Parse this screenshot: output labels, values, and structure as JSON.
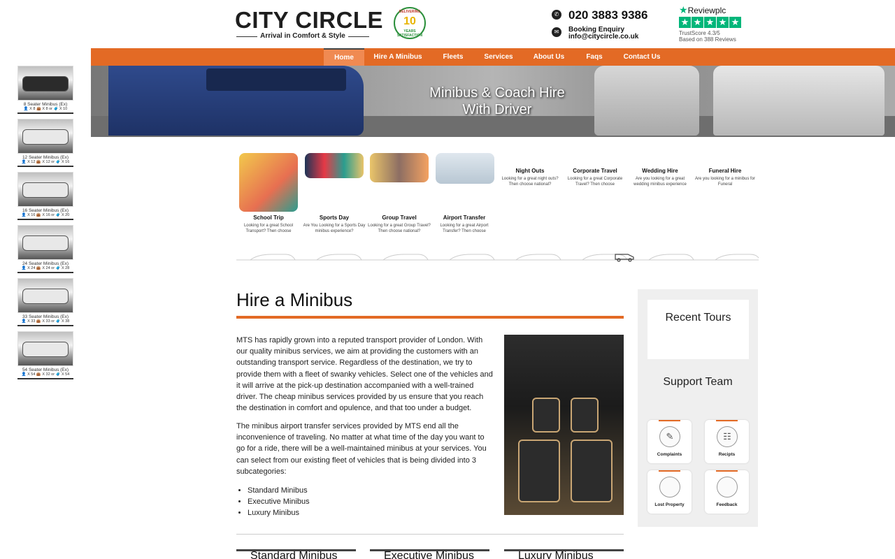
{
  "header": {
    "logo_word": "CITY CIRCLE",
    "logo_tagline": "Arrival in Comfort & Style",
    "badge_top": "DELIVERING",
    "badge_number": "10",
    "badge_years": "YEARS",
    "badge_bottom": "SATISFACTION",
    "phone": "020 3883 9386",
    "enquiry_label": "Booking Enquiry",
    "email": "info@citycircle.co.uk",
    "reviews_brand": "Reviewplc",
    "reviews_score": "TrustScore 4.3/5",
    "reviews_count": "Based on 388 Reviews"
  },
  "nav": [
    {
      "label": "Home",
      "active": true
    },
    {
      "label": "Hire A Minibus"
    },
    {
      "label": "Fleets"
    },
    {
      "label": "Services"
    },
    {
      "label": "About Us"
    },
    {
      "label": "Faqs"
    },
    {
      "label": "Contact Us"
    }
  ],
  "hero": {
    "line1": "Minibus & Coach Hire",
    "line2": "With Driver"
  },
  "fleet": [
    {
      "name": "8 Seater Minibus (Ex)",
      "spec": "👤 X 8  👜 X 8  or  🧳 X 10"
    },
    {
      "name": "12 Seater Minibus (Ex)",
      "spec": "👤 X 12  👜 X 12  or  🧳 X 16"
    },
    {
      "name": "16 Seater Minibus (Ex)",
      "spec": "👤 X 16  👜 X 16  or  🧳 X 20"
    },
    {
      "name": "24 Seater Minibus (Ex)",
      "spec": "👤 X 24  👜 X 24  or  🧳 X 28"
    },
    {
      "name": "33 Seater Minibus (Ex)",
      "spec": "👤 X 33  👜 X 33  or  🧳 X 38"
    },
    {
      "name": "54 Seater Minibus (Ex)",
      "spec": "👤 X 54  👜 X 32  or  🧳 X 54"
    }
  ],
  "services_row1": [
    {
      "title": "School Trip",
      "desc": "Looking for a great School Transport? Then choose"
    },
    {
      "title": "Sports Day",
      "desc": "Are You Looking for a Sports Day minibus experience?"
    },
    {
      "title": "Group Travel",
      "desc": "Looking for a great Group Travel? Then choose national?"
    },
    {
      "title": "Airport Transfer",
      "desc": "Looking for a great Airport Transfer? Then choose"
    }
  ],
  "services_row2": [
    {
      "title": "Night Outs",
      "desc": "Looking for a great night outs? Then choose national?"
    },
    {
      "title": "Corporate Travel",
      "desc": "Looking for a great Corporate Travel? Then choose"
    },
    {
      "title": "Wedding Hire",
      "desc": "Are you looking for a great wedding minibus experience"
    },
    {
      "title": "Funeral Hire",
      "desc": "Are you looking for a minibus for Funeral"
    }
  ],
  "main": {
    "title": "Hire a Minibus",
    "para1": "MTS has rapidly grown into a reputed transport provider of London. With our quality minibus services, we aim at providing the customers with an outstanding transport service. Regardless of the destination, we try to provide them with a fleet of swanky vehicles. Select one of the vehicles and it will arrive at the pick-up destination accompanied with a well-trained driver. The cheap minibus services provided by us ensure that you reach the destination in comfort and opulence, and that too under a budget.",
    "para2": "The minibus airport transfer services provided by MTS end all the inconvenience of traveling. No matter at what time of the day you want to go for a ride, there will be a well-maintained minibus at your services. You can select from our existing fleet of vehicles that is being divided into 3 subcategories:",
    "list": [
      "Standard Minibus",
      "Executive Minibus",
      "Luxury Minibus"
    ],
    "sub_cards": [
      "Standard Minibus",
      "Executive Minibus",
      "Luxury Minibus"
    ]
  },
  "sidebar": {
    "recent_title": "Recent Tours",
    "support_title": "Support Team",
    "items": [
      {
        "label": "Complaints",
        "icon": "complaints-icon"
      },
      {
        "label": "Recipts",
        "icon": "receipts-icon"
      },
      {
        "label": "Lost Property",
        "icon": "lost-property-icon"
      },
      {
        "label": "Feedback",
        "icon": "feedback-icon"
      }
    ]
  },
  "colors": {
    "accent": "#e36a25",
    "trustpilot": "#00b67a"
  }
}
